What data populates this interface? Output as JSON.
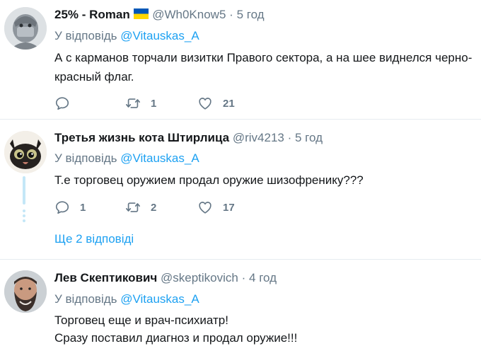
{
  "tweets": [
    {
      "name": "25% - Roman",
      "handle": "@Wh0Know5",
      "dot": "·",
      "time": "5 год",
      "reply_prefix": "У відповідь",
      "mention": "@Vitauskas_A",
      "text_lines": [
        "А с карманов торчали визитки Правого сектора, а на шее виднелся черно-",
        "красный флаг."
      ],
      "replies": "",
      "retweets": "1",
      "likes": "21",
      "avatar": "grey-masked-figure"
    },
    {
      "name": "Третья жизнь кота Штирлица",
      "handle": "@riv4213",
      "dot": "·",
      "time": "5 год",
      "reply_prefix": "У відповідь",
      "mention": "@Vitauskas_A",
      "text_lines": [
        "Т.е торговец оружием продал оружие шизофренику???"
      ],
      "replies": "1",
      "retweets": "2",
      "likes": "17",
      "avatar": "black-cat"
    },
    {
      "name": "Лев Скептикович",
      "handle": "@skeptikovich",
      "dot": "·",
      "time": "4 год",
      "reply_prefix": "У відповідь",
      "mention": "@Vitauskas_A",
      "text_lines": [
        "Торговец еще и врач-психиатр!",
        "Сразу поставил диагноз и продал оружие!!!"
      ],
      "avatar": "bearded-man"
    }
  ],
  "more_replies": "Ще 2 відповіді",
  "icons": {
    "reply": "reply-icon",
    "retweet": "retweet-icon",
    "like": "heart-icon",
    "flag": "ukraine-flag-icon"
  },
  "colors": {
    "link": "#1da1f2",
    "muted": "#657786",
    "thread": "#c4e7f7",
    "flag_blue": "#0057b7",
    "flag_yellow": "#ffd700"
  }
}
